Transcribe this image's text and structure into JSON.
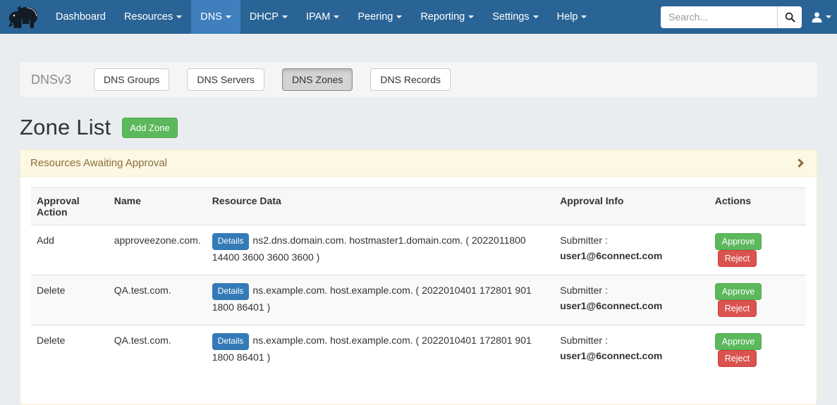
{
  "navbar": {
    "items": [
      {
        "label": "Dashboard",
        "caret": false,
        "active": false
      },
      {
        "label": "Resources",
        "caret": true,
        "active": false
      },
      {
        "label": "DNS",
        "caret": true,
        "active": true
      },
      {
        "label": "DHCP",
        "caret": true,
        "active": false
      },
      {
        "label": "IPAM",
        "caret": true,
        "active": false
      },
      {
        "label": "Peering",
        "caret": true,
        "active": false
      },
      {
        "label": "Reporting",
        "caret": true,
        "active": false
      },
      {
        "label": "Settings",
        "caret": true,
        "active": false
      },
      {
        "label": "Help",
        "caret": true,
        "active": false
      }
    ],
    "search_placeholder": "Search...",
    "icons": [
      "rhino-logo-icon",
      "search-icon",
      "user-icon",
      "caret-down-icon"
    ]
  },
  "subnav": {
    "label": "DNSv3",
    "tabs": [
      {
        "label": "DNS Groups",
        "active": false
      },
      {
        "label": "DNS Servers",
        "active": false
      },
      {
        "label": "DNS Zones",
        "active": true
      },
      {
        "label": "DNS Records",
        "active": false
      }
    ]
  },
  "main": {
    "title": "Zone List",
    "add_zone_label": "Add Zone"
  },
  "panel": {
    "title": "Resources Awaiting Approval",
    "collapse_icon": "chevron-right-icon"
  },
  "table": {
    "headers": [
      "Approval Action",
      "Name",
      "Resource Data",
      "Approval Info",
      "Actions"
    ],
    "details_label": "Details",
    "submitter_label": "Submitter :",
    "approve_label": "Approve",
    "reject_label": "Reject",
    "rows": [
      {
        "action": "Add",
        "name": "approveezone.com.",
        "resource_data": "ns2.dns.domain.com. hostmaster1.domain.com. ( 2022011800 14400 3600 3600 3600 )",
        "submitter": "user1@6connect.com"
      },
      {
        "action": "Delete",
        "name": "QA.test.com.",
        "resource_data": "ns.example.com. host.example.com. ( 2022010401 172801 901 1800 86401 )",
        "submitter": "user1@6connect.com"
      },
      {
        "action": "Delete",
        "name": "QA.test.com.",
        "resource_data": "ns.example.com. host.example.com. ( 2022010401 172801 901 1800 86401 )",
        "submitter": "user1@6connect.com"
      }
    ]
  },
  "colors": {
    "navbar_bg": "#2a6496",
    "navbar_active_bg": "#3f7fbe",
    "page_bg": "#e9edf0",
    "accent_green": "#5cb85c",
    "accent_red": "#d9534f",
    "accent_blue": "#337ab7",
    "warning_bg": "#fcf8e3",
    "warning_text": "#8a6d3b",
    "warning_border": "#faebcc"
  }
}
